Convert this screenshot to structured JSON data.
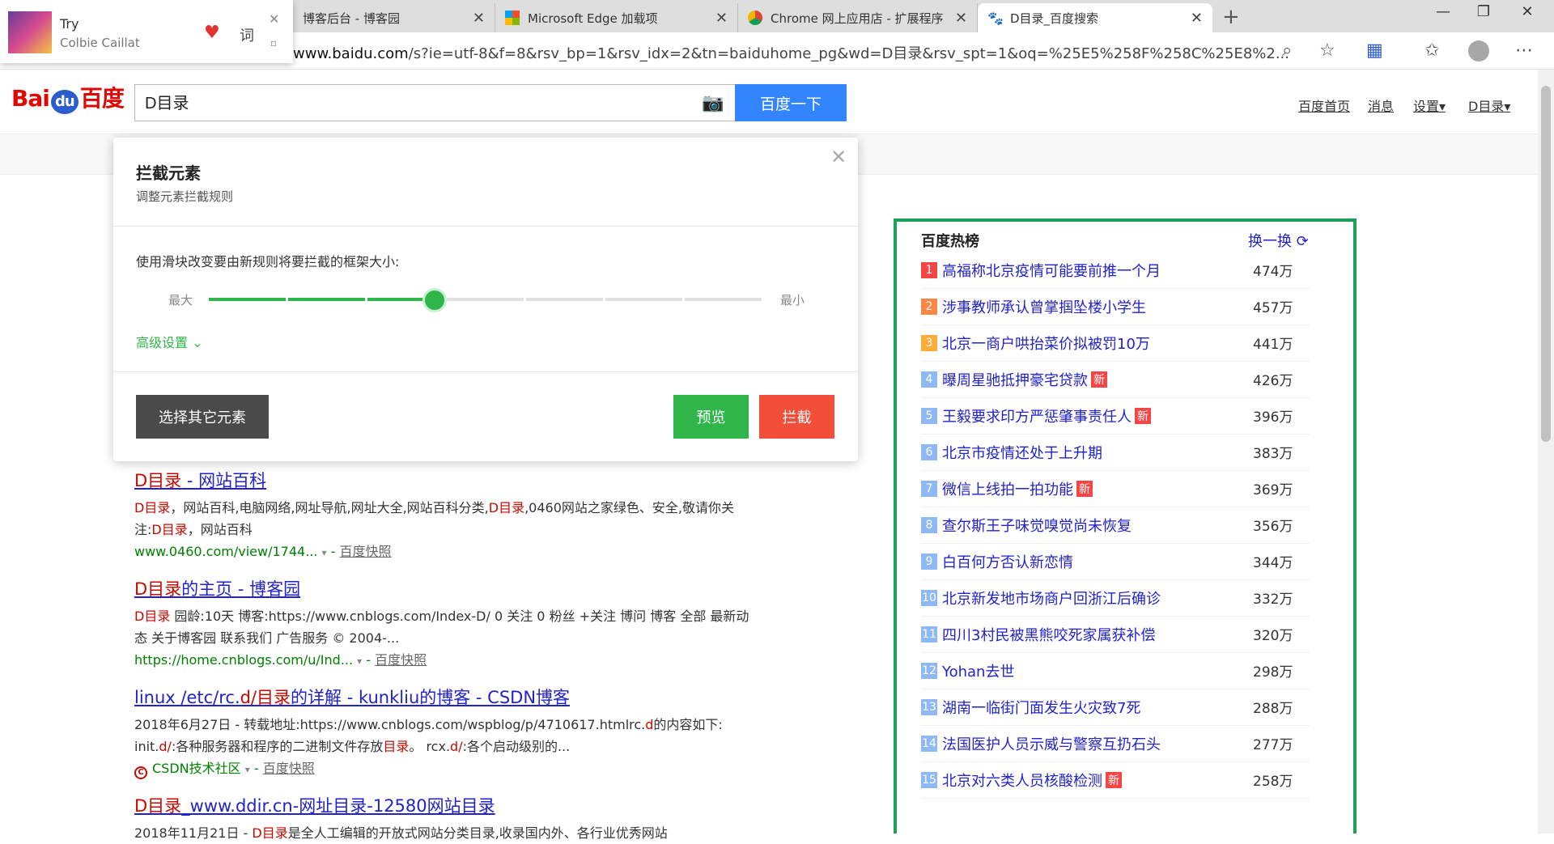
{
  "tabs": [
    {
      "label": "博客后台 - 博客园",
      "icon": "cnblogs-icon"
    },
    {
      "label": "Microsoft Edge 加载项",
      "icon": "microsoft-icon"
    },
    {
      "label": "Chrome 网上应用店 - 扩展程序",
      "icon": "chrome-webstore-icon"
    },
    {
      "label": "D目录_百度搜索",
      "icon": "baidu-paw-icon"
    }
  ],
  "address": {
    "host": "www.baidu.com",
    "path": "/s?ie=utf-8&f=8&rsv_bp=1&rsv_idx=2&tn=baiduhome_pg&wd=D目录&rsv_spt=1&oq=%25E5%258F%258C%25E8%2..."
  },
  "media": {
    "title": "Try",
    "artist": "Colbie Caillat",
    "lyric": "词"
  },
  "search": {
    "query": "D目录",
    "button": "百度一下",
    "logo_left": "Bai",
    "logo_du": "du",
    "logo_right": "百度"
  },
  "nav": {
    "home": "百度首页",
    "messages": "消息",
    "settings": "设置▾",
    "user": "D目录▾"
  },
  "dialog": {
    "title": "拦截元素",
    "subtitle": "调整元素拦截规则",
    "hint": "使用滑块改变要由新规则将要拦截的框架大小:",
    "slider_max": "最大",
    "slider_min": "最小",
    "slider_value": 0.35,
    "advanced": "高级设置 ⌄",
    "select_other": "选择其它元素",
    "preview": "预览",
    "block": "拦截"
  },
  "results": [
    {
      "title_hl": "D目录",
      "title_rest": " - 网站百科",
      "desc": [
        [
          "hl",
          "D目录"
        ],
        [
          "",
          "，网站百科,电脑网络,网址导航,网址大全,网站百科分类,"
        ],
        [
          "hl",
          "D目录"
        ],
        [
          "",
          ",0460网站之家绿色、安全,敬请你关注:"
        ],
        [
          "hl",
          "D目录"
        ],
        [
          "",
          "，网站百科"
        ]
      ],
      "url": "www.0460.com/view/1744...",
      "snap": "百度快照"
    },
    {
      "title_hl": "D目录",
      "title_rest": "的主页 - 博客园",
      "desc": [
        [
          "hl",
          "D目录"
        ],
        [
          "",
          " 园龄:10天 博客:https://www.cnblogs.com/Index-D/ 0 关注 0 粉丝 +关注 博问 博客 全部 最新动态 关于博客园 联系我们 广告服务 © 2004-..."
        ]
      ],
      "url": "https://home.cnblogs.com/u/Ind...",
      "snap": "百度快照"
    },
    {
      "title_pre": "linux /etc/rc.",
      "title_hl": "d/目录",
      "title_rest": "的详解 - kunkliu的博客 - CSDN博客",
      "desc": [
        [
          "",
          "2018年6月27日 - 转载地址:https://www.cnblogs.com/wspblog/p/4710617.htmlrc."
        ],
        [
          "hl",
          "d"
        ],
        [
          "",
          "的内容如下: init."
        ],
        [
          "hl",
          "d/"
        ],
        [
          "",
          ":各种服务器和程序的二进制文件存放"
        ],
        [
          "hl",
          "目录"
        ],
        [
          "",
          "。 rcx."
        ],
        [
          "hl",
          "d/"
        ],
        [
          "",
          ":各个启动级别的..."
        ]
      ],
      "url": "CSDN技术社区",
      "snap": "百度快照"
    },
    {
      "title_hl": "D目录",
      "title_rest": "_www.ddir.cn-网址目录-12580网站目录",
      "desc": [
        [
          "",
          "2018年11月21日 - "
        ],
        [
          "hl",
          "D目录"
        ],
        [
          "",
          "是全人工编辑的开放式网站分类目录,收录国内外、各行业优秀网站"
        ]
      ],
      "url": "",
      "snap": ""
    }
  ],
  "hot": {
    "heading": "百度热榜",
    "refresh": "换一换 ⟳",
    "new_badge": "新",
    "items": [
      {
        "rank": "1",
        "text": "高福称北京疫情可能要前推一个月",
        "count": "474万",
        "new": false,
        "color": "#f54545"
      },
      {
        "rank": "2",
        "text": "涉事教师承认曾掌掴坠楼小学生",
        "count": "457万",
        "new": false,
        "color": "#ff8547"
      },
      {
        "rank": "3",
        "text": "北京一商户哄抬菜价拟被罚10万",
        "count": "441万",
        "new": false,
        "color": "#ffac38"
      },
      {
        "rank": "4",
        "text": "曝周星驰抵押豪宅贷款",
        "count": "426万",
        "new": true,
        "color": "#8eb9f5"
      },
      {
        "rank": "5",
        "text": "王毅要求印方严惩肇事责任人",
        "count": "396万",
        "new": true,
        "color": "#8eb9f5"
      },
      {
        "rank": "6",
        "text": "北京市疫情还处于上升期",
        "count": "383万",
        "new": false,
        "color": "#8eb9f5"
      },
      {
        "rank": "7",
        "text": "微信上线拍一拍功能",
        "count": "369万",
        "new": true,
        "color": "#8eb9f5"
      },
      {
        "rank": "8",
        "text": "查尔斯王子味觉嗅觉尚未恢复",
        "count": "356万",
        "new": false,
        "color": "#8eb9f5"
      },
      {
        "rank": "9",
        "text": "白百何方否认新恋情",
        "count": "344万",
        "new": false,
        "color": "#8eb9f5"
      },
      {
        "rank": "10",
        "text": "北京新发地市场商户回浙江后确诊",
        "count": "332万",
        "new": false,
        "color": "#8eb9f5"
      },
      {
        "rank": "11",
        "text": "四川3村民被黑熊咬死家属获补偿",
        "count": "320万",
        "new": false,
        "color": "#8eb9f5"
      },
      {
        "rank": "12",
        "text": "Yohan去世",
        "count": "298万",
        "new": false,
        "color": "#8eb9f5"
      },
      {
        "rank": "13",
        "text": "湖南一临街门面发生火灾致7死",
        "count": "288万",
        "new": false,
        "color": "#8eb9f5"
      },
      {
        "rank": "14",
        "text": "法国医护人员示威与警察互扔石头",
        "count": "277万",
        "new": false,
        "color": "#8eb9f5"
      },
      {
        "rank": "15",
        "text": "北京对六类人员核酸检测",
        "count": "258万",
        "new": true,
        "color": "#8eb9f5"
      }
    ]
  }
}
